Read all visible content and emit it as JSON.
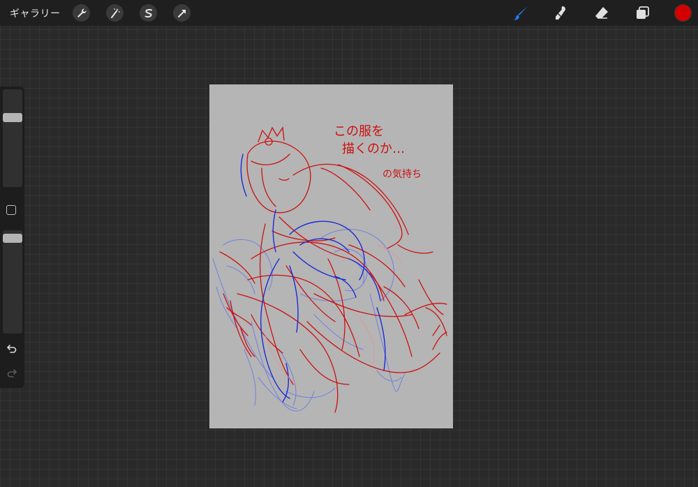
{
  "topbar": {
    "gallery_label": "ギャラリー",
    "actions": [
      {
        "icon": "wrench-icon"
      },
      {
        "icon": "magic-wand-icon"
      },
      {
        "icon": "selection-s-icon"
      },
      {
        "icon": "arrow-transform-icon"
      }
    ],
    "tools": [
      {
        "icon": "brush-icon",
        "active": true
      },
      {
        "icon": "smudge-icon",
        "active": false
      },
      {
        "icon": "eraser-icon",
        "active": false
      },
      {
        "icon": "layers-icon",
        "active": false
      }
    ],
    "current_color": "#d40000",
    "active_tool_color": "#1e7cf2"
  },
  "sidebar": {
    "brush_size_level": 0.73,
    "opacity_level": 0.96,
    "undo_icon": "undo-icon",
    "redo_icon": "redo-icon"
  },
  "canvas": {
    "background": "#b5b5b5",
    "note_line_1": "この服を",
    "note_line_2": "描くのか…",
    "note_line_3": "の気持ち",
    "red_color": "#cc1010",
    "blue_color": "#1a2bd6",
    "light_blue_color": "#6d7fe0"
  }
}
